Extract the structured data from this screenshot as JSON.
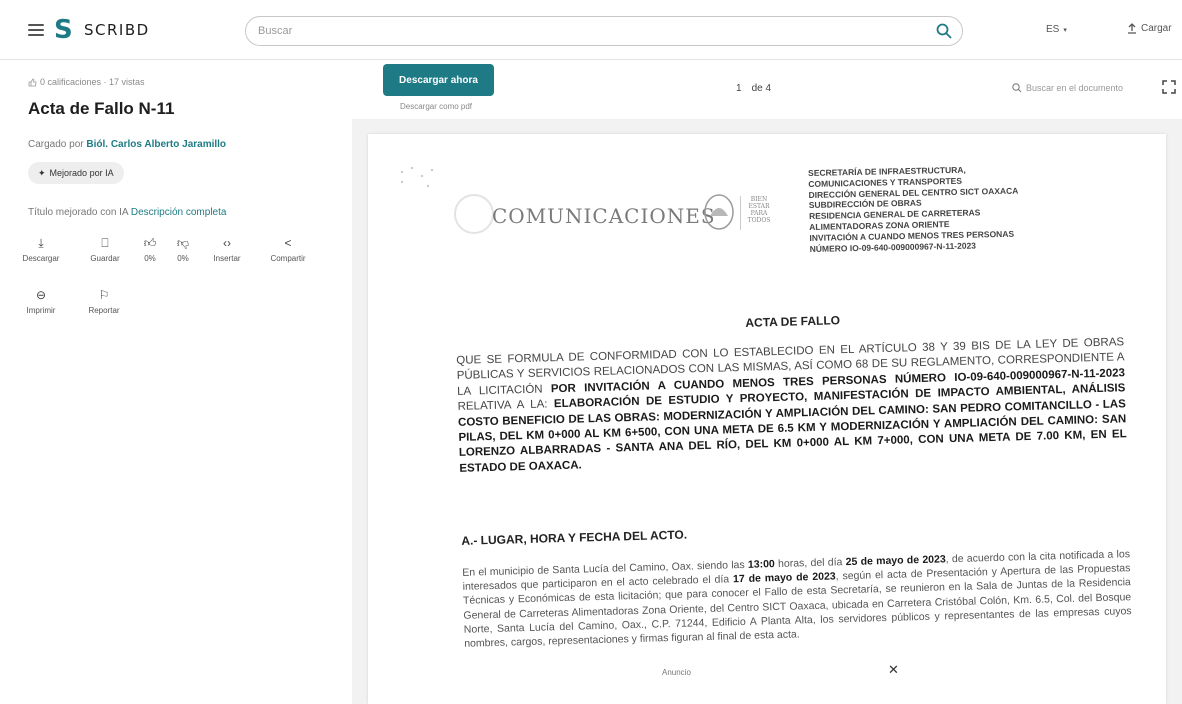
{
  "topbar": {
    "brand": "SCRIBD",
    "search_placeholder": "Buscar",
    "language": "ES",
    "upload_label": "Cargar"
  },
  "sidebar": {
    "breadcrumb": "0 calificaciones · 17 vistas",
    "title": "Acta de Fallo N-11",
    "uploaded_prefix": "Cargado por",
    "uploader": "Biól. Carlos Alberto Jaramillo",
    "ai_badge": "Mejorado por IA",
    "desc_prefix": "Título mejorado con IA",
    "desc_link": "Descripción completa",
    "actions": [
      {
        "label": "Descargar",
        "icon": "download-icon"
      },
      {
        "label": "Guardar",
        "icon": "bookmark-icon"
      },
      {
        "label": "0%",
        "icon": "thumbs-up-icon"
      },
      {
        "label": "0%",
        "icon": "thumbs-down-icon"
      },
      {
        "label": "Insertar",
        "icon": "embed-icon"
      },
      {
        "label": "Compartir",
        "icon": "share-icon"
      },
      {
        "label": "Imprimir",
        "icon": "print-icon"
      },
      {
        "label": "Reportar",
        "icon": "flag-icon"
      }
    ]
  },
  "viewer": {
    "download_button": "Descargar ahora",
    "download_sub": "Descargar como pdf",
    "page_current": "1",
    "page_total": "de 4",
    "doc_search_placeholder": "Buscar en el documento"
  },
  "document": {
    "comms": "COMUNICACIONES",
    "logo_small": "BIEN ESTAR PARA TODOS",
    "header_lines": [
      "SECRETARÍA DE INFRAESTRUCTURA,",
      "COMUNICACIONES Y TRANSPORTES",
      "DIRECCIÓN GENERAL DEL CENTRO SICT OAXACA",
      "SUBDIRECCIÓN DE OBRAS",
      "RESIDENCIA GENERAL DE CARRETERAS",
      "ALIMENTADORAS ZONA ORIENTE",
      "INVITACIÓN A CUANDO MENOS TRES PERSONAS",
      "NÚMERO IO-09-640-009000967-N-11-2023"
    ],
    "acta_title": "ACTA DE FALLO",
    "intro_plain": "QUE SE FORMULA DE CONFORMIDAD CON LO ESTABLECIDO EN EL ARTÍCULO 38 Y 39 BIS DE LA LEY DE OBRAS PÚBLICAS Y SERVICIOS RELACIONADOS CON LAS MISMAS, ASÍ COMO 68 DE SU REGLAMENTO, CORRESPONDIENTE A LA LICITACIÓN",
    "intro_bold1": "POR INVITACIÓN A CUANDO MENOS TRES PERSONAS NÚMERO IO-09-640-009000967-N-11-2023",
    "intro_plain2": "RELATIVA A LA:",
    "intro_bold2": "ELABORACIÓN DE ESTUDIO Y PROYECTO, MANIFESTACIÓN DE IMPACTO AMBIENTAL, ANÁLISIS COSTO BENEFICIO DE LAS OBRAS: MODERNIZACIÓN Y AMPLIACIÓN DEL CAMINO: SAN PEDRO COMITANCILLO - LAS PILAS, DEL KM 0+000 AL KM 6+500, CON UNA META DE 6.5 KM Y MODERNIZACIÓN Y AMPLIACIÓN DEL CAMINO: SAN LORENZO ALBARRADAS - SANTA ANA DEL RÍO, DEL KM 0+000 AL KM 7+000, CON UNA META DE 7.00 KM, EN EL ESTADO DE OAXACA.",
    "section_title": "A.- LUGAR, HORA Y FECHA DEL ACTO.",
    "p1": "En el municipio de Santa Lucía del Camino, Oax. siendo las",
    "p_time": "13:00",
    "p2": "horas, del día",
    "p_date1": "25 de mayo de 2023",
    "p3": ", de acuerdo con la cita notificada a los interesados que participaron en el acto celebrado el día",
    "p_date2": "17 de mayo de 2023",
    "p4": ", según el acta de Presentación y Apertura de las Propuestas Técnicas y Económicas de esta licitación; que para conocer el Fallo de esta Secretaría, se reunieron en la Sala de Juntas de la Residencia General de Carreteras Alimentadoras Zona Oriente, del Centro SICT Oaxaca, ubicada en Carretera Cristóbal Colón, Km. 6.5, Col. del Bosque Norte, Santa Lucía del Camino, Oax., C.P. 71244, Edificio A Planta Alta, los servidores públicos y representantes de las empresas cuyos nombres, cargos, representaciones y firmas figuran al final de esta acta."
  },
  "ad": {
    "label": "Anuncio",
    "close": "✕"
  },
  "colors": {
    "accent": "#1e7b85"
  }
}
